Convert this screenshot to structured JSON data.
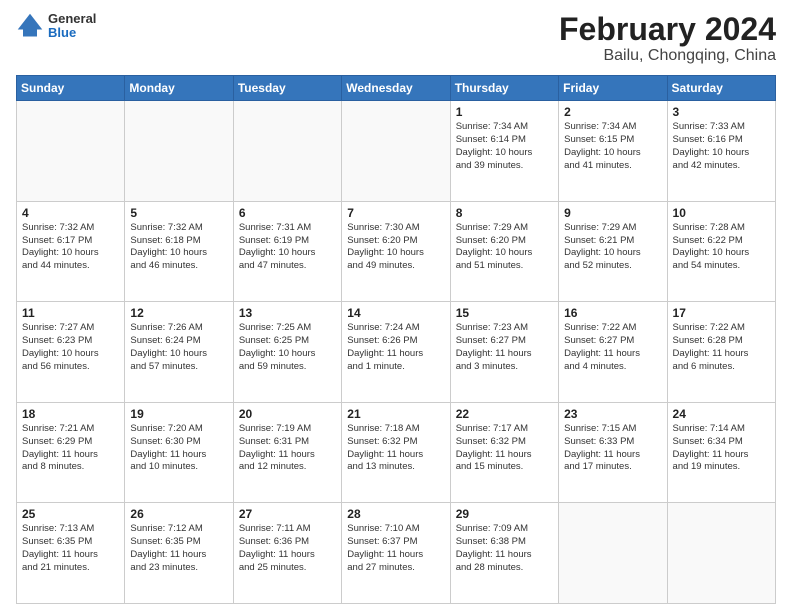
{
  "header": {
    "logo_general": "General",
    "logo_blue": "Blue",
    "title": "February 2024",
    "subtitle": "Bailu, Chongqing, China"
  },
  "columns": [
    "Sunday",
    "Monday",
    "Tuesday",
    "Wednesday",
    "Thursday",
    "Friday",
    "Saturday"
  ],
  "weeks": [
    [
      {
        "day": "",
        "info": ""
      },
      {
        "day": "",
        "info": ""
      },
      {
        "day": "",
        "info": ""
      },
      {
        "day": "",
        "info": ""
      },
      {
        "day": "1",
        "info": "Sunrise: 7:34 AM\nSunset: 6:14 PM\nDaylight: 10 hours\nand 39 minutes."
      },
      {
        "day": "2",
        "info": "Sunrise: 7:34 AM\nSunset: 6:15 PM\nDaylight: 10 hours\nand 41 minutes."
      },
      {
        "day": "3",
        "info": "Sunrise: 7:33 AM\nSunset: 6:16 PM\nDaylight: 10 hours\nand 42 minutes."
      }
    ],
    [
      {
        "day": "4",
        "info": "Sunrise: 7:32 AM\nSunset: 6:17 PM\nDaylight: 10 hours\nand 44 minutes."
      },
      {
        "day": "5",
        "info": "Sunrise: 7:32 AM\nSunset: 6:18 PM\nDaylight: 10 hours\nand 46 minutes."
      },
      {
        "day": "6",
        "info": "Sunrise: 7:31 AM\nSunset: 6:19 PM\nDaylight: 10 hours\nand 47 minutes."
      },
      {
        "day": "7",
        "info": "Sunrise: 7:30 AM\nSunset: 6:20 PM\nDaylight: 10 hours\nand 49 minutes."
      },
      {
        "day": "8",
        "info": "Sunrise: 7:29 AM\nSunset: 6:20 PM\nDaylight: 10 hours\nand 51 minutes."
      },
      {
        "day": "9",
        "info": "Sunrise: 7:29 AM\nSunset: 6:21 PM\nDaylight: 10 hours\nand 52 minutes."
      },
      {
        "day": "10",
        "info": "Sunrise: 7:28 AM\nSunset: 6:22 PM\nDaylight: 10 hours\nand 54 minutes."
      }
    ],
    [
      {
        "day": "11",
        "info": "Sunrise: 7:27 AM\nSunset: 6:23 PM\nDaylight: 10 hours\nand 56 minutes."
      },
      {
        "day": "12",
        "info": "Sunrise: 7:26 AM\nSunset: 6:24 PM\nDaylight: 10 hours\nand 57 minutes."
      },
      {
        "day": "13",
        "info": "Sunrise: 7:25 AM\nSunset: 6:25 PM\nDaylight: 10 hours\nand 59 minutes."
      },
      {
        "day": "14",
        "info": "Sunrise: 7:24 AM\nSunset: 6:26 PM\nDaylight: 11 hours\nand 1 minute."
      },
      {
        "day": "15",
        "info": "Sunrise: 7:23 AM\nSunset: 6:27 PM\nDaylight: 11 hours\nand 3 minutes."
      },
      {
        "day": "16",
        "info": "Sunrise: 7:22 AM\nSunset: 6:27 PM\nDaylight: 11 hours\nand 4 minutes."
      },
      {
        "day": "17",
        "info": "Sunrise: 7:22 AM\nSunset: 6:28 PM\nDaylight: 11 hours\nand 6 minutes."
      }
    ],
    [
      {
        "day": "18",
        "info": "Sunrise: 7:21 AM\nSunset: 6:29 PM\nDaylight: 11 hours\nand 8 minutes."
      },
      {
        "day": "19",
        "info": "Sunrise: 7:20 AM\nSunset: 6:30 PM\nDaylight: 11 hours\nand 10 minutes."
      },
      {
        "day": "20",
        "info": "Sunrise: 7:19 AM\nSunset: 6:31 PM\nDaylight: 11 hours\nand 12 minutes."
      },
      {
        "day": "21",
        "info": "Sunrise: 7:18 AM\nSunset: 6:32 PM\nDaylight: 11 hours\nand 13 minutes."
      },
      {
        "day": "22",
        "info": "Sunrise: 7:17 AM\nSunset: 6:32 PM\nDaylight: 11 hours\nand 15 minutes."
      },
      {
        "day": "23",
        "info": "Sunrise: 7:15 AM\nSunset: 6:33 PM\nDaylight: 11 hours\nand 17 minutes."
      },
      {
        "day": "24",
        "info": "Sunrise: 7:14 AM\nSunset: 6:34 PM\nDaylight: 11 hours\nand 19 minutes."
      }
    ],
    [
      {
        "day": "25",
        "info": "Sunrise: 7:13 AM\nSunset: 6:35 PM\nDaylight: 11 hours\nand 21 minutes."
      },
      {
        "day": "26",
        "info": "Sunrise: 7:12 AM\nSunset: 6:35 PM\nDaylight: 11 hours\nand 23 minutes."
      },
      {
        "day": "27",
        "info": "Sunrise: 7:11 AM\nSunset: 6:36 PM\nDaylight: 11 hours\nand 25 minutes."
      },
      {
        "day": "28",
        "info": "Sunrise: 7:10 AM\nSunset: 6:37 PM\nDaylight: 11 hours\nand 27 minutes."
      },
      {
        "day": "29",
        "info": "Sunrise: 7:09 AM\nSunset: 6:38 PM\nDaylight: 11 hours\nand 28 minutes."
      },
      {
        "day": "",
        "info": ""
      },
      {
        "day": "",
        "info": ""
      }
    ]
  ]
}
